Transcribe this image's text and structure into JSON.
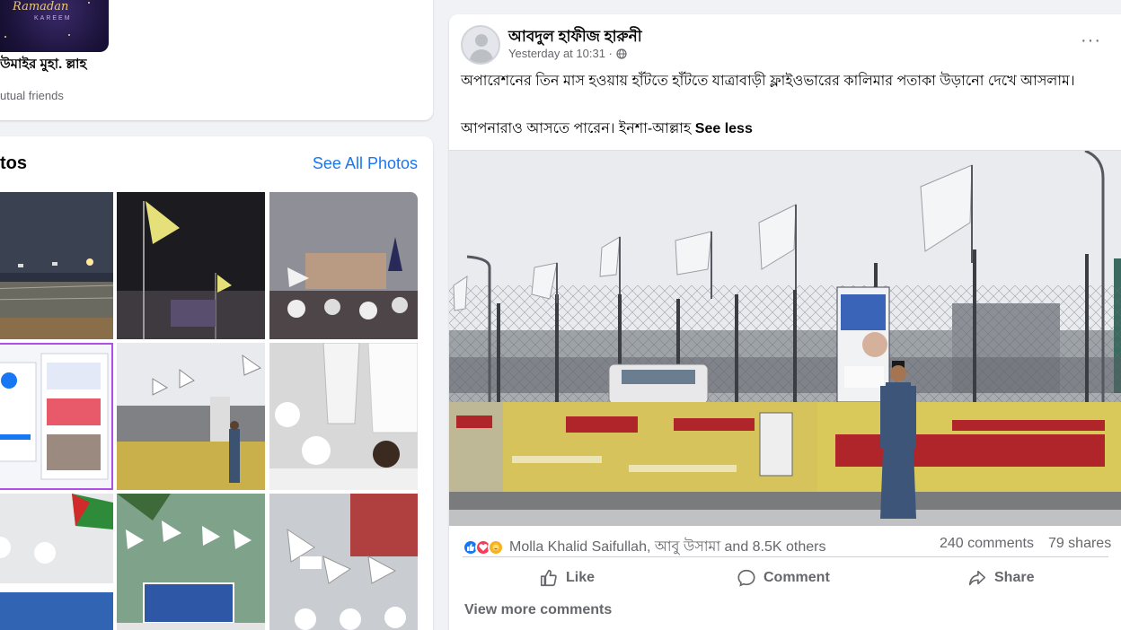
{
  "friend": {
    "thumb_text": "Ramadan",
    "thumb_subtext": "KAREEM",
    "name": "উমাইর মুহা. ল্লাহ",
    "mutual": "utual friends"
  },
  "photos": {
    "title": "tos",
    "see_all": "See All Photos",
    "items": [
      "photo-1",
      "photo-2",
      "photo-3",
      "photo-4",
      "photo-5",
      "photo-6",
      "photo-7",
      "photo-8",
      "photo-9"
    ]
  },
  "post": {
    "author": "আবদুল হাফীজ হারুনী",
    "timestamp": "Yesterday at 10:31 ·",
    "privacy_icon": "globe-icon",
    "more": "···",
    "text_line1": "অপারেশনের তিন মাস হওয়ায় হাঁটতে হাঁটতে যাত্রাবাড়ী ফ্লাইওভারের কালিমার পতাকা উড়ানো দেখে আসলাম।",
    "text_line2": "আপনারাও আসতে পারেন। ইনশা-আল্লাহ",
    "see_less": "See less",
    "reactors": "Molla Khalid Saifullah, আবু উসামা and 8.5K others",
    "comments": "240 comments",
    "shares": "79 shares",
    "like_label": "Like",
    "comment_label": "Comment",
    "share_label": "Share",
    "view_more": "View more comments"
  },
  "colors": {
    "accent": "#1877f2",
    "secondary_text": "#65676b",
    "background": "#f0f2f5"
  }
}
